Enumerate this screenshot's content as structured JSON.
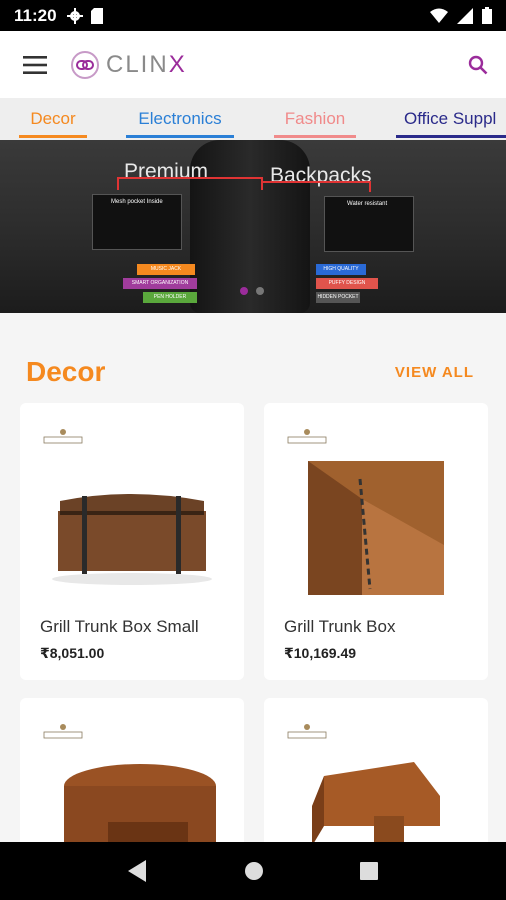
{
  "status": {
    "time": "11:20"
  },
  "app": {
    "logo_text": "CLIN",
    "logo_x": "X"
  },
  "tabs": [
    {
      "label": "Decor",
      "color": "#f5891f"
    },
    {
      "label": "Electronics",
      "color": "#2a7fd6"
    },
    {
      "label": "Fashion",
      "color": "#f08a8a"
    },
    {
      "label": "Office Suppl",
      "color": "#2a2a8a"
    }
  ],
  "banner": {
    "title_left": "Premium",
    "title_right": "Backpacks",
    "thumb_left_caption": "Mesh pocket Inside",
    "thumb_right_caption": "Water resistant",
    "chips_left": [
      "MUSIC JACK",
      "SMART ORGANIZATION",
      "PEN HOLDER"
    ],
    "chips_right": [
      "HIGH QUALITY",
      "PUFFY DESIGN",
      "HIDDEN POCKET"
    ]
  },
  "section": {
    "title": "Decor",
    "view_all": "VIEW ALL"
  },
  "products": [
    {
      "name": "Grill Trunk Box Small",
      "price": "₹8,051.00"
    },
    {
      "name": "Grill Trunk Box",
      "price": "₹10,169.49"
    },
    {
      "name": "",
      "price": ""
    },
    {
      "name": "",
      "price": ""
    }
  ]
}
